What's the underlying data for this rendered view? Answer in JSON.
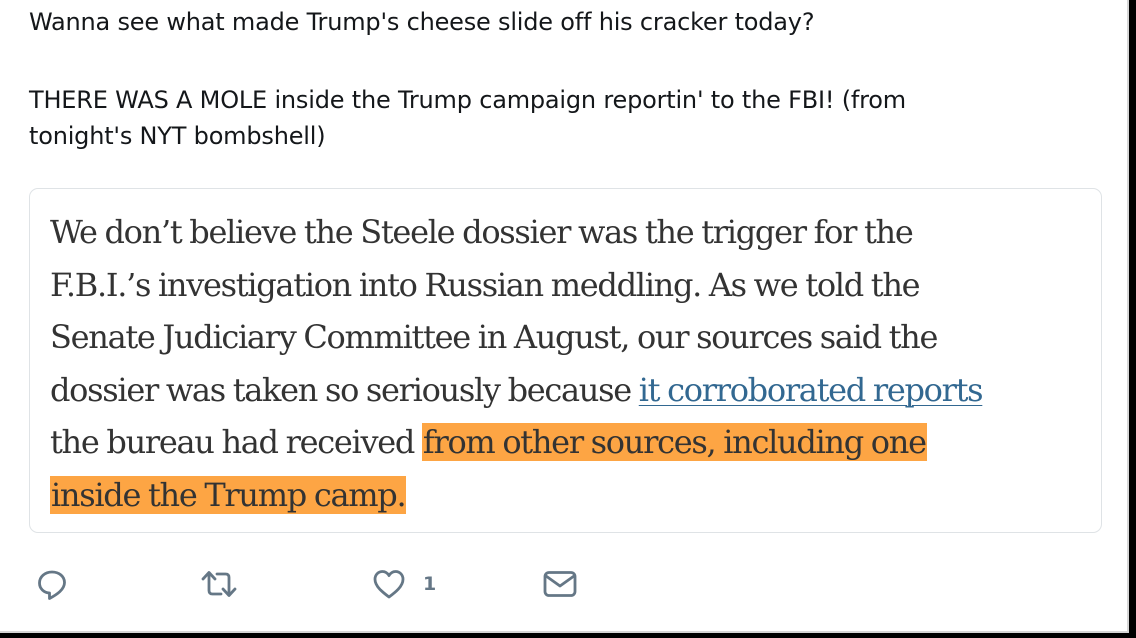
{
  "tweet": {
    "text_lines": [
      "Wanna see what made Trump's cheese slide off his cracker today?",
      "THERE WAS A MOLE inside the Trump campaign reportin' to the FBI!  (from",
      "tonight's NYT bombshell)"
    ]
  },
  "quote": {
    "line1": "We don’t believe the Steele dossier was the trigger for the",
    "line2": "F.B.I.’s investigation into Russian meddling. As we told the",
    "line3": "Senate Judiciary Committee in August, our sources said the",
    "line4_before_link": "dossier was taken so seriously because ",
    "link_text": "it corroborated reports",
    "line5_plain": "the bureau had received ",
    "line5_highlight": "from other sources, including one",
    "line6_highlight": "inside the Trump camp."
  },
  "actions": {
    "reply_icon": "reply-icon",
    "retweet_icon": "retweet-icon",
    "like_icon": "heart-icon",
    "like_count": "1",
    "message_icon": "envelope-icon",
    "icon_color": "#657786"
  },
  "colors": {
    "highlight": "#fda544",
    "link": "#326891",
    "card_border": "#dfe3e6"
  }
}
